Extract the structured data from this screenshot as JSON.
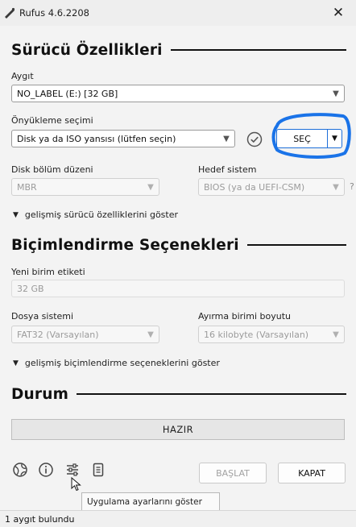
{
  "window": {
    "title": "Rufus 4.6.2208",
    "close_glyph": "✕"
  },
  "drive_properties": {
    "section_title": "Sürücü Özellikleri",
    "device_label": "Aygıt",
    "device_value": "NO_LABEL (E:) [32 GB]",
    "boot_selection_label": "Önyükleme seçimi",
    "boot_selection_value": "Disk ya da ISO yansısı (lütfen seçin)",
    "select_button_label": "SEÇ",
    "partition_scheme_label": "Disk bölüm düzeni",
    "partition_scheme_value": "MBR",
    "target_system_label": "Hedef sistem",
    "target_system_value": "BIOS (ya da UEFI-CSM)",
    "target_help": "?",
    "advanced_toggle_label": "gelişmiş sürücü özelliklerini göster"
  },
  "format_options": {
    "section_title": "Biçimlendirme Seçenekleri",
    "volume_label_label": "Yeni birim etiketi",
    "volume_label_value": "32 GB",
    "file_system_label": "Dosya sistemi",
    "file_system_value": "FAT32 (Varsayılan)",
    "cluster_size_label": "Ayırma birimi boyutu",
    "cluster_size_value": "16 kilobyte (Varsayılan)",
    "advanced_toggle_label": "gelişmiş biçimlendirme seçeneklerini göster"
  },
  "status": {
    "section_title": "Durum",
    "progress_text": "HAZIR",
    "progress_fraction": 0
  },
  "actions": {
    "start_label": "BAŞLAT",
    "close_label": "KAPAT"
  },
  "tooltip": {
    "text": "Uygulama ayarlarını göster"
  },
  "status_bar": {
    "text": "1 aygıt bulundu"
  },
  "colors": {
    "accent": "#1e6fd9",
    "annotation": "#1a73e8"
  },
  "icons": [
    "rufus-icon",
    "globe-icon",
    "info-icon",
    "settings-sliders-icon",
    "log-icon",
    "check-hash-icon",
    "chevron-down-icon",
    "mouse-cursor-icon"
  ]
}
